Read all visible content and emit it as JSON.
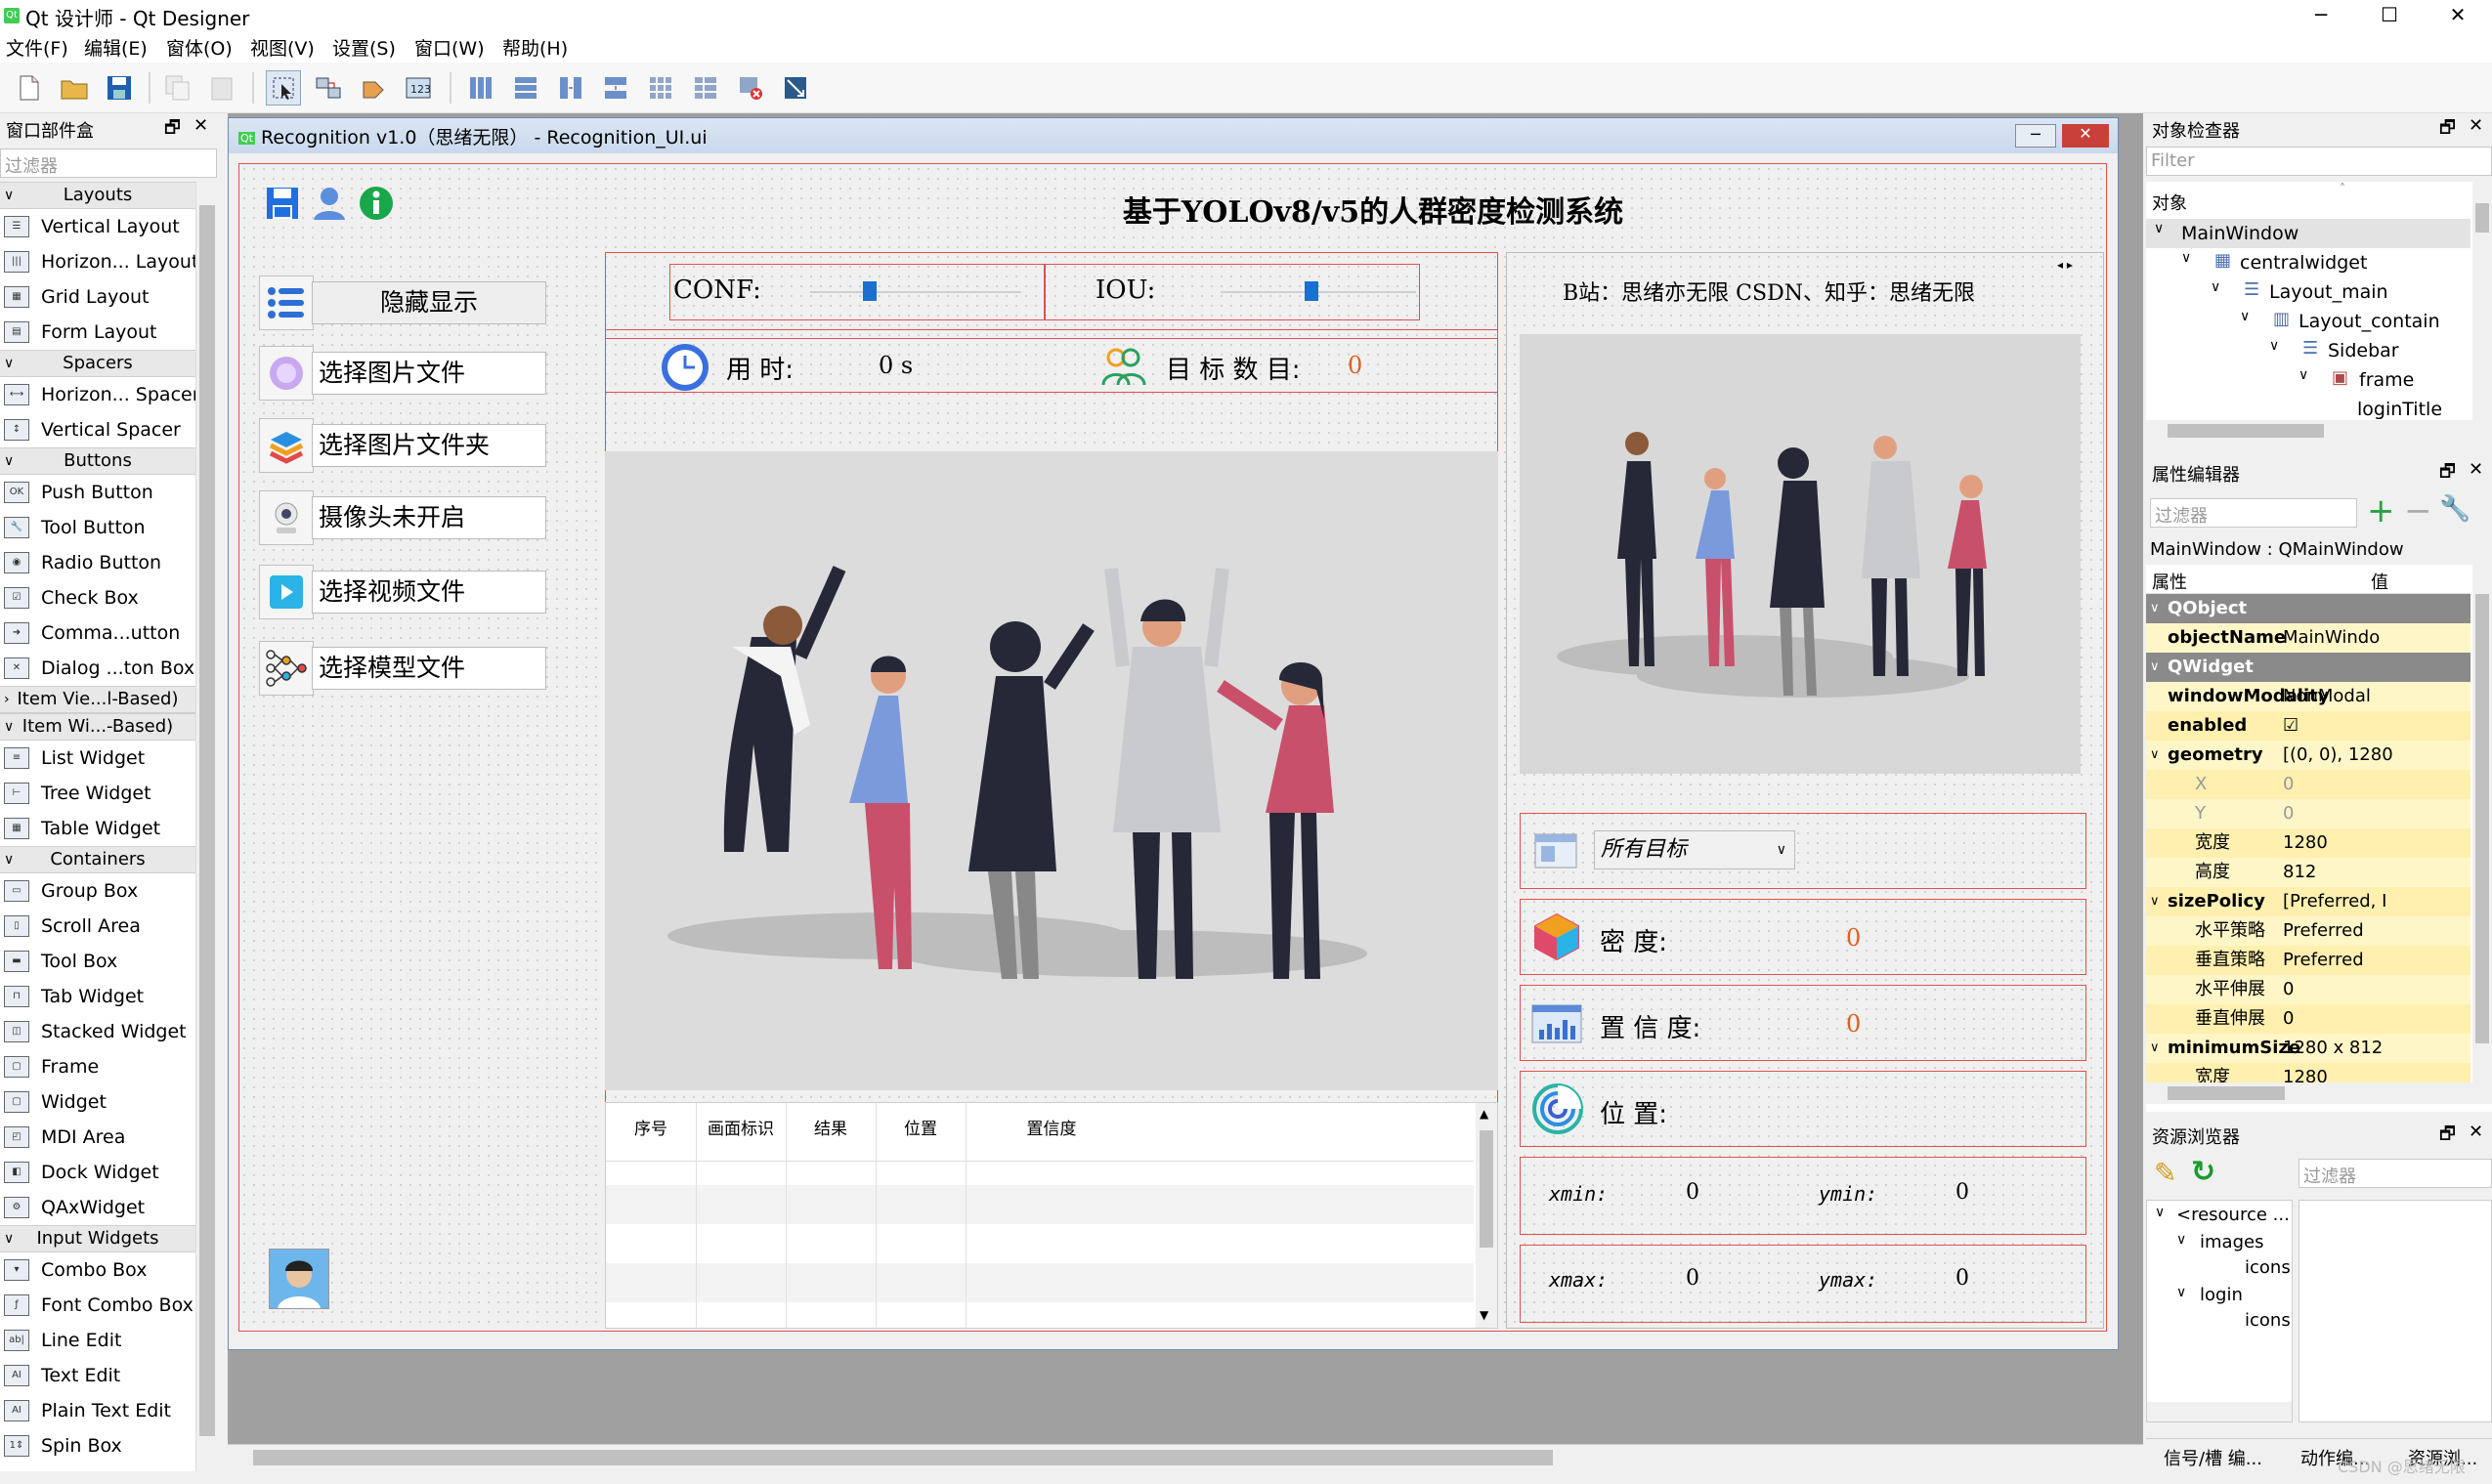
{
  "window": {
    "title": "Qt 设计师 - Qt Designer",
    "app_icon": "Qt",
    "min": "─",
    "max": "☐",
    "close": "✕"
  },
  "menu": [
    "文件(F)",
    "编辑(E)",
    "窗体(O)",
    "视图(V)",
    "设置(S)",
    "窗口(W)",
    "帮助(H)"
  ],
  "widgetbox": {
    "title": "窗口部件盒",
    "filter_placeholder": "过滤器",
    "cats": {
      "layouts": "Layouts",
      "spacers": "Spacers",
      "buttons": "Buttons",
      "itemview": "Item Vie...l-Based)",
      "itemwidget": "Item Wi...-Based)",
      "containers": "Containers",
      "input": "Input Widgets"
    },
    "items": {
      "vl": "Vertical Layout",
      "hl": "Horizon... Layout",
      "gl": "Grid Layout",
      "fl": "Form Layout",
      "hs": "Horizon... Spacer",
      "vs": "Vertical Spacer",
      "pb": "Push Button",
      "tb": "Tool Button",
      "rb": "Radio Button",
      "cb": "Check Box",
      "clb": "Comma...utton",
      "dbb": "Dialog ...ton Box",
      "lw": "List Widget",
      "trw": "Tree Widget",
      "tw": "Table Widget",
      "gb": "Group Box",
      "sa": "Scroll Area",
      "tbx": "Tool Box",
      "tabw": "Tab Widget",
      "sw": "Stacked Widget",
      "fr": "Frame",
      "wd": "Widget",
      "mdi": "MDI Area",
      "dw": "Dock Widget",
      "qax": "QAxWidget",
      "combo": "Combo Box",
      "fcombo": "Font Combo Box",
      "le": "Line Edit",
      "te": "Text Edit",
      "pte": "Plain Text Edit",
      "sb": "Spin Box"
    }
  },
  "form": {
    "title": "Recognition v1.0（思绪无限） - Recognition_UI.ui",
    "qt_badge": "Qt",
    "heading": "基于YOLOv8/v5的人群密度检测系统",
    "side": {
      "hide": "隐藏显示",
      "img": "选择图片文件",
      "folder": "选择图片文件夹",
      "cam": "摄像头未开启",
      "video": "选择视频文件",
      "model": "选择模型文件"
    },
    "conf_label": "CONF:",
    "iou_label": "IOU:",
    "conf_value": 0.25,
    "iou_value": 0.5,
    "time_label": "用 时:",
    "time_value": "0 s",
    "count_label": "目 标 数 目:",
    "count_value": "0",
    "table_headers": [
      "序号",
      "画面标识",
      "结果",
      "位置",
      "置信度"
    ],
    "credit": "B站：思绪亦无限 CSDN、知乎：思绪无限",
    "target_select": "所有目标",
    "density_label": "密 度:",
    "density_value": "0",
    "conf2_label": "置 信 度:",
    "conf2_value": "0",
    "pos_label": "位 置:",
    "xmin_label": "xmin:",
    "xmin": "0",
    "ymin_label": "ymin:",
    "ymin": "0",
    "xmax_label": "xmax:",
    "xmax": "0",
    "ymax_label": "ymax:",
    "ymax": "0"
  },
  "inspector": {
    "title": "对象检查器",
    "filter": "Filter",
    "col": "对象",
    "nodes": [
      "MainWindow",
      "centralwidget",
      "Layout_main",
      "Layout_contain",
      "Sidebar",
      "frame",
      "loginTitle"
    ]
  },
  "props": {
    "title": "属性编辑器",
    "filter_placeholder": "过滤器",
    "caption": "MainWindow : QMainWindow",
    "col_prop": "属性",
    "col_val": "值",
    "rows": [
      {
        "k": "QObject",
        "v": ""
      },
      {
        "k": "objectName",
        "v": "MainWindo"
      },
      {
        "k": "QWidget",
        "v": ""
      },
      {
        "k": "windowModality",
        "v": "NonModal"
      },
      {
        "k": "enabled",
        "v": "☑"
      },
      {
        "k": "geometry",
        "v": "[(0, 0), 1280"
      },
      {
        "k": "X",
        "v": "0"
      },
      {
        "k": "Y",
        "v": "0"
      },
      {
        "k": "宽度",
        "v": "1280"
      },
      {
        "k": "高度",
        "v": "812"
      },
      {
        "k": "sizePolicy",
        "v": "[Preferred, I"
      },
      {
        "k": "水平策略",
        "v": "Preferred"
      },
      {
        "k": "垂直策略",
        "v": "Preferred"
      },
      {
        "k": "水平伸展",
        "v": "0"
      },
      {
        "k": "垂直伸展",
        "v": "0"
      },
      {
        "k": "minimumSize",
        "v": "1280 x 812"
      },
      {
        "k": "宽度",
        "v": "1280"
      }
    ]
  },
  "resources": {
    "title": "资源浏览器",
    "filter_placeholder": "过滤器",
    "tree": [
      "<resource ...",
      "images",
      "icons",
      "login",
      "icons"
    ]
  },
  "bottom_tabs": [
    "信号/槽 编...",
    "动作编...",
    "资源浏..."
  ],
  "watermark": "CSDN @思绪无限",
  "colors": {
    "accent": "#1a6fd1",
    "red_border": "#e05050",
    "value_orange": "#e06020",
    "prop_yellow": "#fff6c8",
    "prop_header": "#8a8a8a"
  }
}
